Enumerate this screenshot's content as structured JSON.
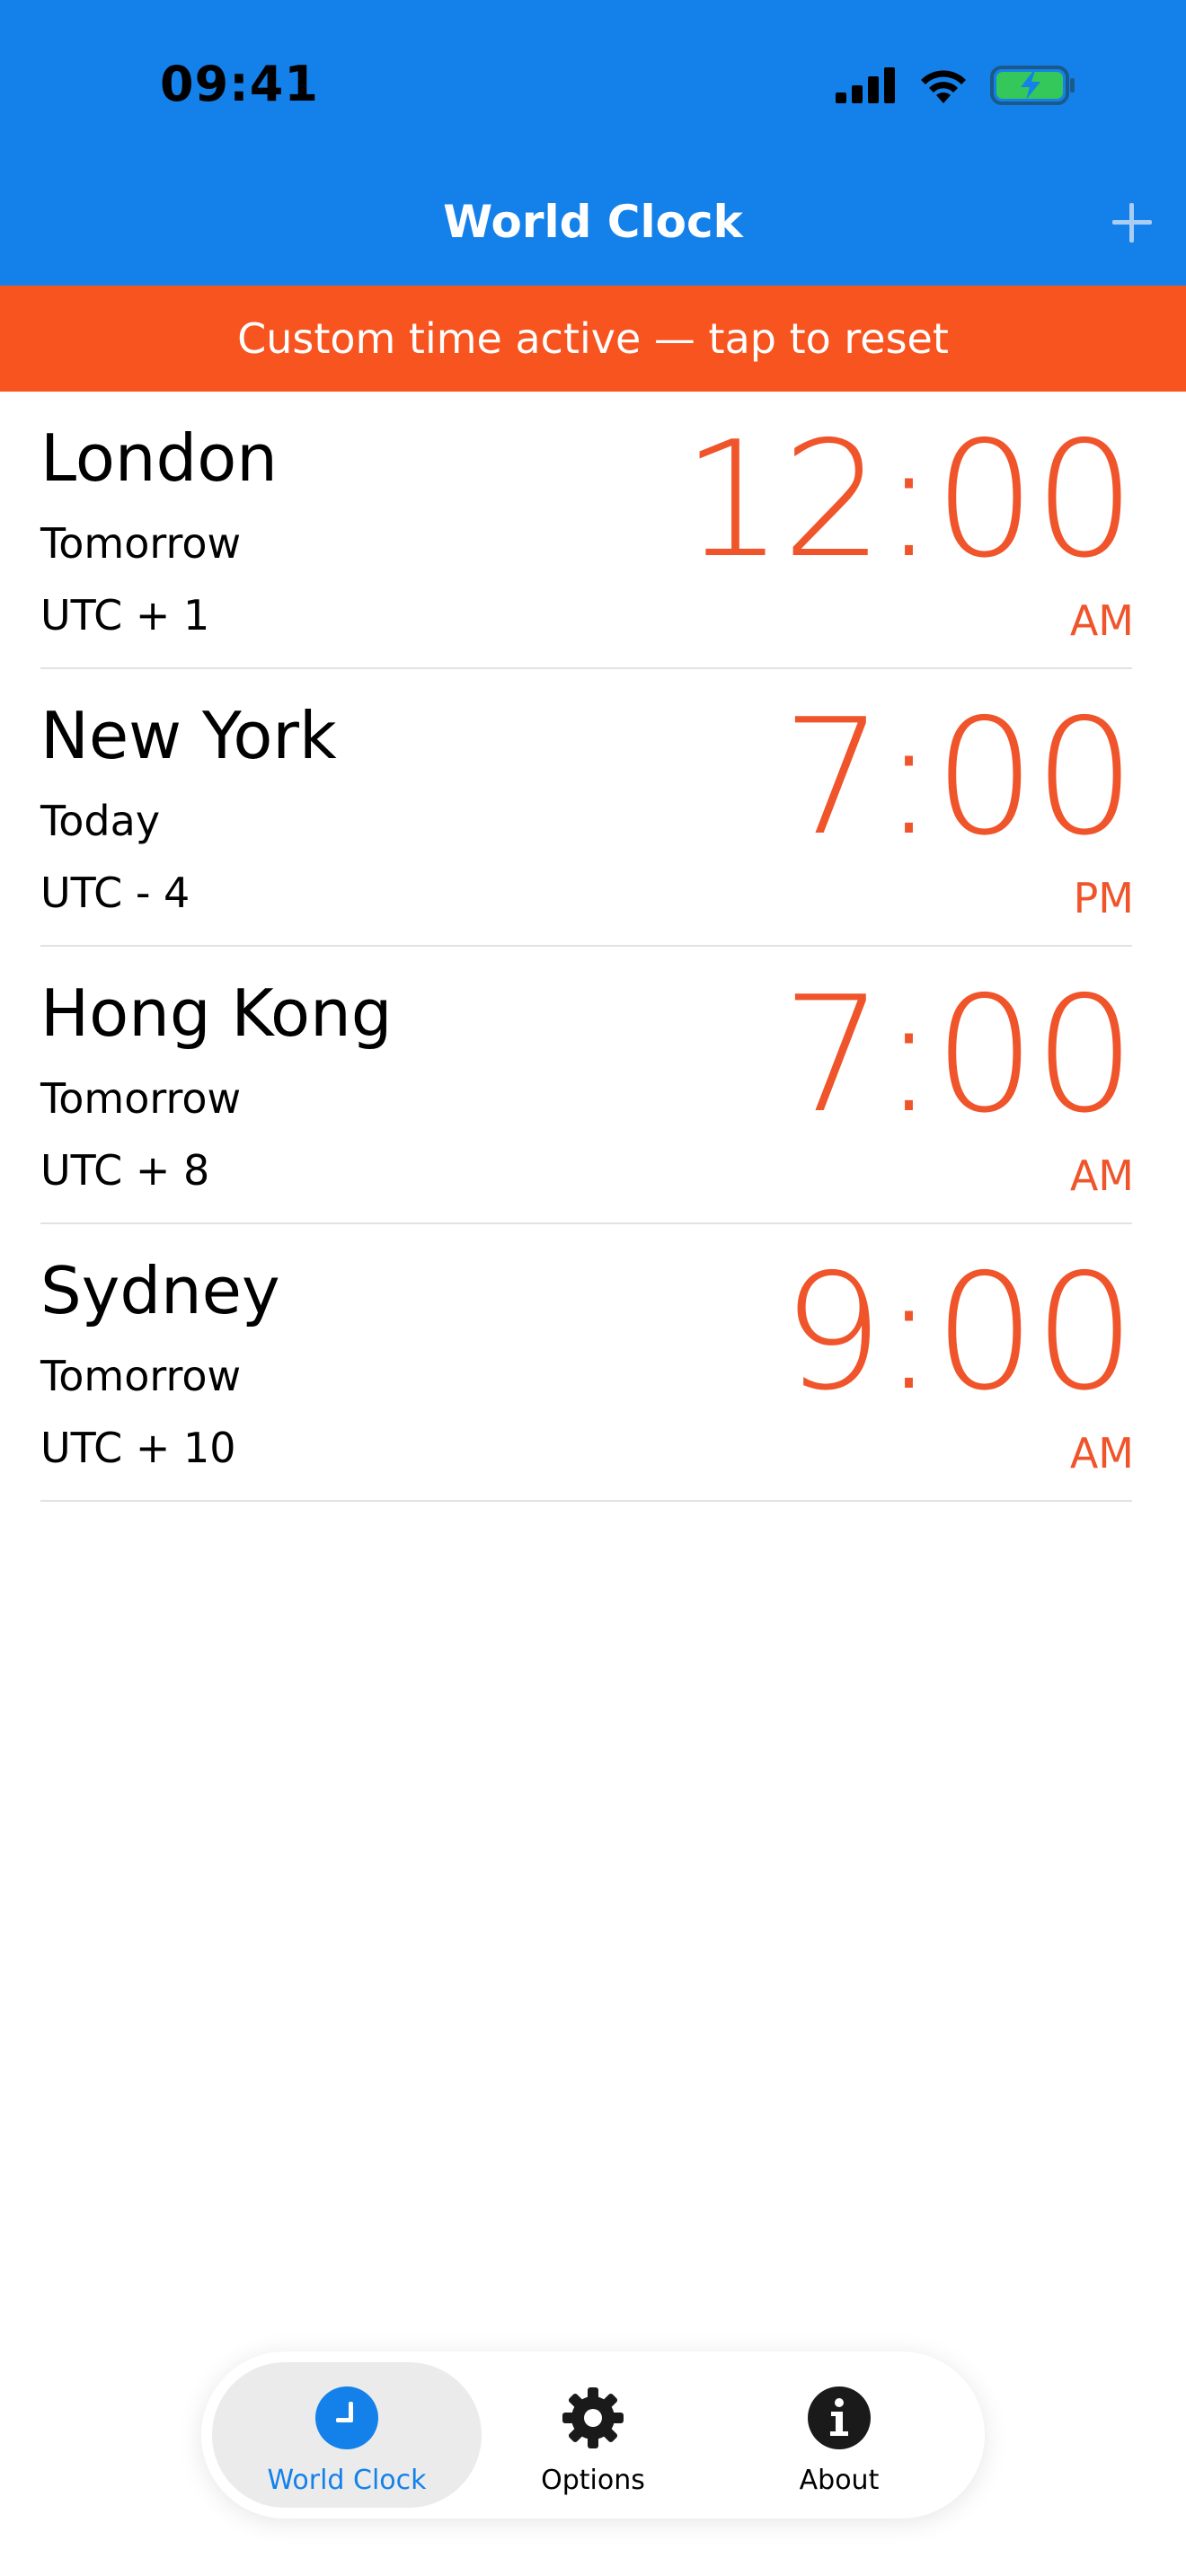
{
  "status_bar": {
    "time": "09:41"
  },
  "nav": {
    "title": "World Clock",
    "add_icon": "plus-icon"
  },
  "banner": {
    "text": "Custom time active — tap to reset"
  },
  "clocks": [
    {
      "city": "London",
      "day": "Tomorrow",
      "offset": "UTC + 1",
      "time": "12:00",
      "ampm": "AM"
    },
    {
      "city": "New York",
      "day": "Today",
      "offset": "UTC - 4",
      "time": "7:00",
      "ampm": "PM"
    },
    {
      "city": "Hong Kong",
      "day": "Tomorrow",
      "offset": "UTC + 8",
      "time": "7:00",
      "ampm": "AM"
    },
    {
      "city": "Sydney",
      "day": "Tomorrow",
      "offset": "UTC + 10",
      "time": "9:00",
      "ampm": "AM"
    }
  ],
  "tabbar": {
    "tabs": [
      {
        "label": "World Clock",
        "icon": "clock-icon",
        "active": true
      },
      {
        "label": "Options",
        "icon": "gear-icon",
        "active": false
      },
      {
        "label": "About",
        "icon": "info-icon",
        "active": false
      }
    ]
  },
  "colors": {
    "header_blue": "#1481EA",
    "banner_orange": "#F85420",
    "time_orange": "#F0542A",
    "battery_green": "#34C759"
  }
}
